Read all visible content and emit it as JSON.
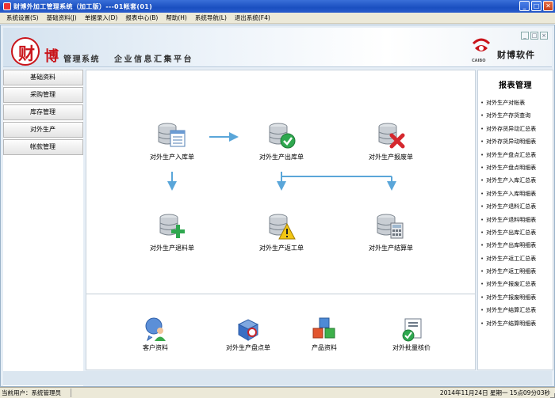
{
  "window": {
    "title": "财博外加工管理系统（加工版）---01帐套(01)",
    "buttons": [
      "_",
      "□",
      "✕"
    ]
  },
  "menu": [
    "系统设置(S)",
    "基础资料(J)",
    "单据录入(D)",
    "报表中心(B)",
    "帮助(H)",
    "系统导航(L)",
    "退出系统(F4)"
  ],
  "banner": {
    "logo_char": "财",
    "brand_char": "博",
    "brand_sub": "管理系统",
    "slogan": "企业信息汇集平台",
    "caibo": "CAIBO",
    "company": "财博软件",
    "mini_buttons": [
      "_",
      "□",
      "×"
    ]
  },
  "leftnav": [
    "基础资料",
    "采购管理",
    "库存管理",
    "对外生产",
    "帐款管理"
  ],
  "center": {
    "flow": [
      {
        "label": "对外生产入库单",
        "icon": "db-list-icon"
      },
      {
        "label": "对外生产出库单",
        "icon": "db-check-icon"
      },
      {
        "label": "对外生产报废单",
        "icon": "db-cross-icon"
      },
      {
        "label": "对外生产退料单",
        "icon": "db-plus-icon"
      },
      {
        "label": "对外生产返工单",
        "icon": "db-warning-icon"
      },
      {
        "label": "对外生产结算单",
        "icon": "db-calculator-icon"
      }
    ],
    "quick": [
      {
        "label": "客户资料",
        "icon": "customer-icon"
      },
      {
        "label": "对外生产盘点单",
        "icon": "box-icon"
      },
      {
        "label": "产品资料",
        "icon": "cubes-icon"
      },
      {
        "label": "对外批量核价",
        "icon": "price-check-icon"
      }
    ]
  },
  "report": {
    "title": "报表管理",
    "items": [
      "对外生产对帐表",
      "对外生产存货查询",
      "对外存货异动汇总表",
      "对外存货异动明细表",
      "对外生产盘点汇总表",
      "对外生产盘点明细表",
      "对外生产入库汇总表",
      "对外生产入库明细表",
      "对外生产退料汇总表",
      "对外生产退料明细表",
      "对外生产出库汇总表",
      "对外生产出库明细表",
      "对外生产返工汇总表",
      "对外生产返工明细表",
      "对外生产报废汇总表",
      "对外生产报废明细表",
      "对外生产结算汇总表",
      "对外生产结算明细表"
    ]
  },
  "status": {
    "user": "当前用户：系统管理员",
    "time": "2014年11月24日 星期一  15点09分03秒"
  },
  "colors": {
    "titlebar": "#1a4fc0",
    "brand_red": "#c9141a",
    "arrow": "#5aa6d9",
    "check_green": "#2fa84f",
    "cross_red": "#d5282e"
  }
}
